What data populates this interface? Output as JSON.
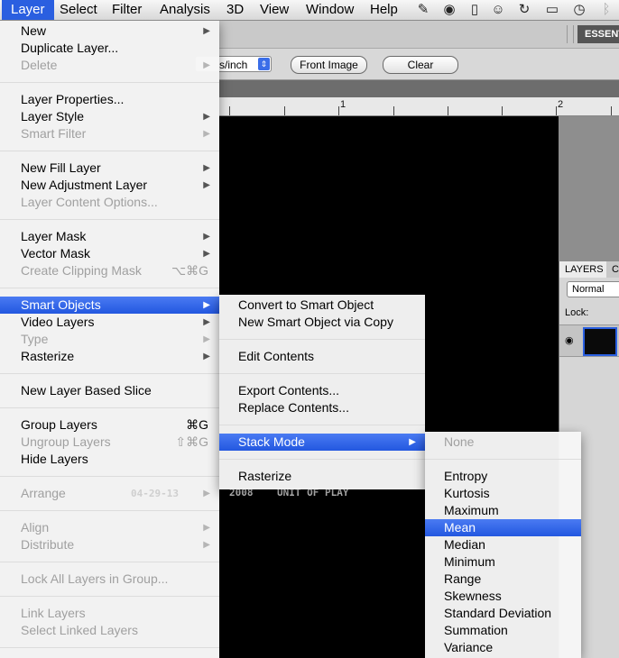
{
  "menubar": {
    "items": [
      "Layer",
      "Select",
      "Filter",
      "Analysis",
      "3D",
      "View",
      "Window",
      "Help"
    ],
    "icons": [
      "script-icon",
      "globe-sync-icon",
      "document-icon",
      "accessibility-icon",
      "sync-icon",
      "display-icon",
      "time-machine-icon",
      "bluetooth-icon"
    ]
  },
  "options_bar": {
    "resolution_unit": "s/inch",
    "front_image_label": "Front Image",
    "clear_label": "Clear",
    "workspace_label": "ESSENT"
  },
  "ruler": {
    "labels": [
      "1",
      "2"
    ]
  },
  "canvas": {
    "text_left": "04-29-13",
    "text_mid": "2008",
    "text_right": "UNIT OF PLAY"
  },
  "layers_panel": {
    "tab_layers": "LAYERS",
    "tab_other": "C",
    "blend_mode": "Normal",
    "lock_label": "Lock:"
  },
  "layer_menu": {
    "items": [
      {
        "label": "New",
        "disabled": false,
        "submenu": true
      },
      {
        "label": "Duplicate Layer...",
        "disabled": false
      },
      {
        "label": "Delete",
        "disabled": true,
        "submenu": true
      },
      {
        "sep": true
      },
      {
        "label": "Layer Properties...",
        "disabled": false
      },
      {
        "label": "Layer Style",
        "disabled": false,
        "submenu": true
      },
      {
        "label": "Smart Filter",
        "disabled": true,
        "submenu": true
      },
      {
        "sep": true
      },
      {
        "label": "New Fill Layer",
        "disabled": false,
        "submenu": true
      },
      {
        "label": "New Adjustment Layer",
        "disabled": false,
        "submenu": true
      },
      {
        "label": "Layer Content Options...",
        "disabled": true
      },
      {
        "sep": true
      },
      {
        "label": "Layer Mask",
        "disabled": false,
        "submenu": true
      },
      {
        "label": "Vector Mask",
        "disabled": false,
        "submenu": true
      },
      {
        "label": "Create Clipping Mask",
        "disabled": true,
        "shortcut": "⌥⌘G"
      },
      {
        "sep": true
      },
      {
        "label": "Smart Objects",
        "disabled": false,
        "submenu": true,
        "highlighted": true
      },
      {
        "label": "Video Layers",
        "disabled": false,
        "submenu": true
      },
      {
        "label": "Type",
        "disabled": true,
        "submenu": true
      },
      {
        "label": "Rasterize",
        "disabled": false,
        "submenu": true
      },
      {
        "sep": true
      },
      {
        "label": "New Layer Based Slice",
        "disabled": false
      },
      {
        "sep": true
      },
      {
        "label": "Group Layers",
        "disabled": false,
        "shortcut": "⌘G"
      },
      {
        "label": "Ungroup Layers",
        "disabled": true,
        "shortcut": "⇧⌘G"
      },
      {
        "label": "Hide Layers",
        "disabled": false
      },
      {
        "sep": true
      },
      {
        "label": "Arrange",
        "disabled": true,
        "submenu": true
      },
      {
        "sep": true
      },
      {
        "label": "Align",
        "disabled": true,
        "submenu": true
      },
      {
        "label": "Distribute",
        "disabled": true,
        "submenu": true
      },
      {
        "sep": true
      },
      {
        "label": "Lock All Layers in Group...",
        "disabled": true
      },
      {
        "sep": true
      },
      {
        "label": "Link Layers",
        "disabled": true
      },
      {
        "label": "Select Linked Layers",
        "disabled": true
      },
      {
        "sep": true
      }
    ]
  },
  "smart_objects_menu": {
    "items": [
      {
        "label": "Convert to Smart Object",
        "disabled": false
      },
      {
        "label": "New Smart Object via Copy",
        "disabled": false
      },
      {
        "sep": true
      },
      {
        "label": "Edit Contents",
        "disabled": false
      },
      {
        "sep": true
      },
      {
        "label": "Export Contents...",
        "disabled": false
      },
      {
        "label": "Replace Contents...",
        "disabled": false
      },
      {
        "sep": true
      },
      {
        "label": "Stack Mode",
        "disabled": false,
        "submenu": true,
        "highlighted": true
      },
      {
        "sep": true
      },
      {
        "label": "Rasterize",
        "disabled": false
      }
    ]
  },
  "stack_mode_menu": {
    "items": [
      {
        "label": "None",
        "disabled": true
      },
      {
        "sep": true
      },
      {
        "label": "Entropy",
        "disabled": false
      },
      {
        "label": "Kurtosis",
        "disabled": false
      },
      {
        "label": "Maximum",
        "disabled": false
      },
      {
        "label": "Mean",
        "disabled": false,
        "highlighted": true
      },
      {
        "label": "Median",
        "disabled": false
      },
      {
        "label": "Minimum",
        "disabled": false
      },
      {
        "label": "Range",
        "disabled": false
      },
      {
        "label": "Skewness",
        "disabled": false
      },
      {
        "label": "Standard Deviation",
        "disabled": false
      },
      {
        "label": "Summation",
        "disabled": false
      },
      {
        "label": "Variance",
        "disabled": false
      }
    ]
  }
}
